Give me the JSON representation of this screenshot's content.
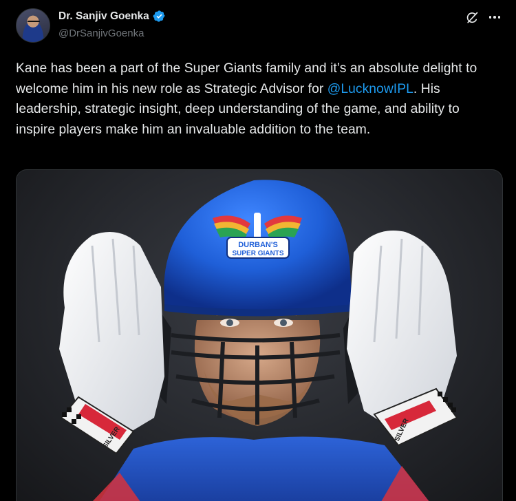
{
  "author": {
    "display_name": "Dr. Sanjiv Goenka",
    "handle": "@DrSanjivGoenka",
    "verified": true
  },
  "header_actions": {
    "grok_icon": "grok-icon",
    "more_icon": "more-icon"
  },
  "tweet": {
    "text_part1": "Kane has been a part of the Super Giants family and it’s an absolute delight to welcome him in his new role as Strategic Advisor for ",
    "mention": "@LucknowIPL",
    "text_part2": ". His leadership, strategic insight, deep understanding of the game, and ability to inspire players make him an invaluable addition to the team."
  },
  "media": {
    "helmet_logo_line1": "DURBAN'S",
    "helmet_logo_line2": "SUPER GIANTS",
    "glove_brand": "SILVER"
  },
  "colors": {
    "background": "#000000",
    "text": "#e7e9ea",
    "muted": "#71767b",
    "accent": "#1d9bf0",
    "helmet_blue": "#1f5fd8"
  }
}
